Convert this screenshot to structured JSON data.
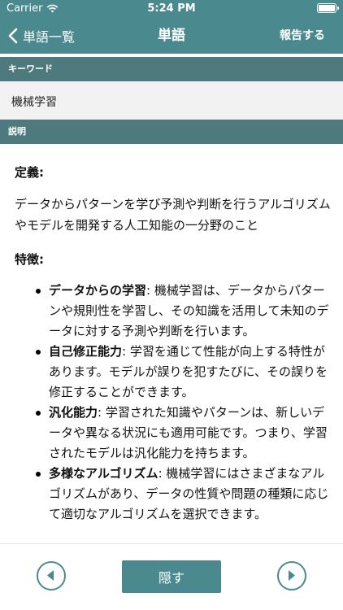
{
  "status_bar": {
    "carrier": "Carrier",
    "time": "5:24 PM"
  },
  "nav": {
    "back_label": "単語一覧",
    "title": "単語",
    "report_label": "報告する"
  },
  "sections": {
    "keyword_header": "キーワード",
    "description_header": "説明"
  },
  "keyword": "機械学習",
  "description": {
    "definition_heading": "定義:",
    "definition_text": "データからパターンを学び予測や判断を行うアルゴリズムやモデルを開発する人工知能の一分野のこと",
    "features_heading": "特徴:",
    "features": [
      {
        "term": "データからの学習",
        "text": ": 機械学習は、データからパターンや規則性を学習し、その知識を活用して未知のデータに対する予測や判断を行います。"
      },
      {
        "term": "自己修正能力",
        "text": ": 学習を通じて性能が向上する特性があります。モデルが誤りを犯すたびに、その誤りを修正することができます。"
      },
      {
        "term": "汎化能力",
        "text": ": 学習された知識やパターンは、新しいデータや異なる状況にも適用可能です。つまり、学習されたモデルは汎化能力を持ちます。"
      },
      {
        "term": "多様なアルゴリズム",
        "text": ": 機械学習にはさまざまなアルゴリズムがあり、データの性質や問題の種類に応じて適切なアルゴリズムを選択できます。"
      }
    ]
  },
  "bottom": {
    "hide_label": "隠す"
  },
  "icons": {
    "wifi": "wifi-icon",
    "battery": "battery-icon",
    "back": "chevron-left-icon",
    "prev": "arrow-left-circle-icon",
    "next": "arrow-right-circle-icon"
  },
  "colors": {
    "nav_bg": "#4a8a8e",
    "section_header_bg": "#4e7a7e",
    "keyword_bg": "#f2f2f2"
  }
}
